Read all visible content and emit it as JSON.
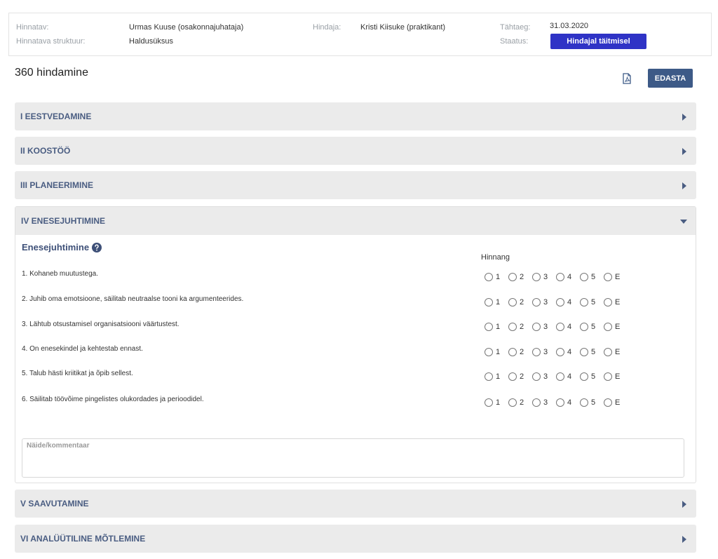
{
  "info": {
    "appraisee_label": "Hinnatav:",
    "appraisee_value": "Urmas Kuuse (osakonnajuhataja)",
    "structure_label": "Hinnatava struktuur:",
    "structure_value": "Haldusüksus",
    "evaluator_label": "Hindaja:",
    "evaluator_value": "Kristi Kiisuke (praktikant)",
    "deadline_label": "Tähtaeg:",
    "deadline_value": "31.03.2020",
    "status_label": "Staatus:",
    "status_value": "Hindajal täitmisel",
    "status_color": "#2f33c6"
  },
  "page": {
    "title": "360 hindamine",
    "pdf_icon": "pdf-icon",
    "forward_label": "EDASTA",
    "accent_color": "#3d5a87"
  },
  "sections": [
    {
      "title": "I EESTVEDAMINE",
      "expanded": false
    },
    {
      "title": "II KOOSTÖÖ",
      "expanded": false
    },
    {
      "title": "III PLANEERIMINE",
      "expanded": false
    },
    {
      "title": "IV ENESEJUHTIMINE",
      "expanded": true
    },
    {
      "title": "V SAAVUTAMINE",
      "expanded": false
    },
    {
      "title": "VI ANALÜÜTILINE MÕTLEMINE",
      "expanded": false
    }
  ],
  "expanded_section": {
    "subheading": "Enesejuhtimine",
    "help_icon": "question-circle-icon",
    "rating_header": "Hinnang",
    "rating_options": [
      "1",
      "2",
      "3",
      "4",
      "5",
      "E"
    ],
    "questions": [
      "1. Kohaneb muutustega.",
      "2. Juhib oma emotsioone, säilitab neutraalse tooni ka argumenteerides.",
      "3. Lähtub otsustamisel organisatsiooni väärtustest.",
      "4. On enesekindel ja kehtestab ennast.",
      "5. Talub hästi kriitikat ja õpib sellest.",
      "6. Säilitab töövõime pingelistes olukordades ja perioodidel."
    ],
    "comment_placeholder": "Näide/kommentaar"
  }
}
